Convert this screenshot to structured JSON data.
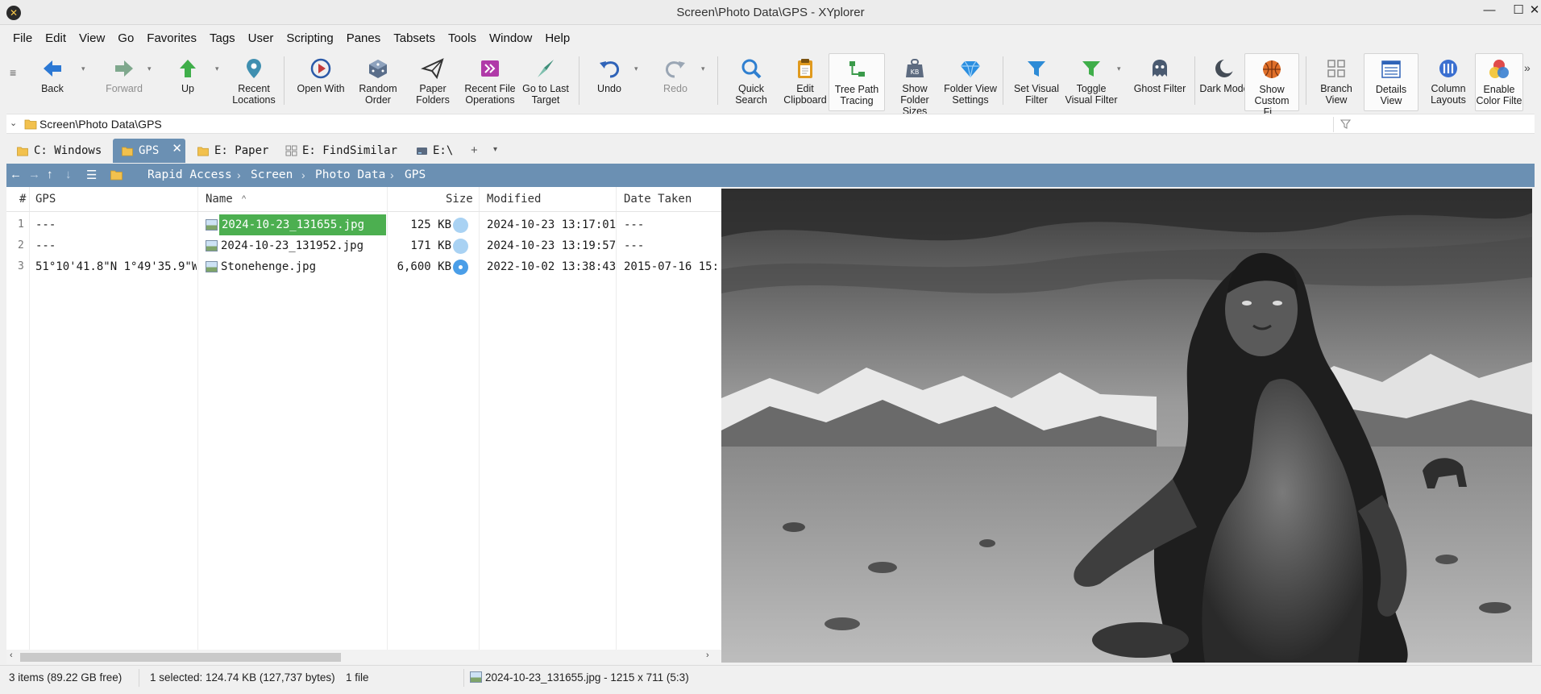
{
  "window": {
    "title": "Screen\\Photo Data\\GPS - XYplorer",
    "minimize": "—",
    "maximize": "☐",
    "close": "✕"
  },
  "menu": [
    "File",
    "Edit",
    "View",
    "Go",
    "Favorites",
    "Tags",
    "User",
    "Scripting",
    "Panes",
    "Tabsets",
    "Tools",
    "Window",
    "Help"
  ],
  "toolbar": {
    "grip": "≡",
    "overflow": "»",
    "buttons": [
      {
        "label": "Back",
        "icon": "back-arrow-icon",
        "color": "#2b78d4"
      },
      {
        "label": "Forward",
        "icon": "forward-arrow-icon",
        "color": "#7fa88d"
      },
      {
        "label": "Up",
        "icon": "up-arrow-icon",
        "color": "#3fae4a"
      },
      {
        "label": "Recent\nLocations",
        "icon": "map-pin-icon",
        "color": "#3f8fb0"
      },
      {
        "label": "Open With",
        "icon": "open-with-icon",
        "color": "#c33b3b"
      },
      {
        "label": "Random\nOrder",
        "icon": "dice-icon",
        "color": "#5a6e8a"
      },
      {
        "label": "Paper\nFolders",
        "icon": "paper-plane-icon",
        "color": "#333333"
      },
      {
        "label": "Recent File\nOperations",
        "icon": "file-operations-icon",
        "color": "#b03aa8"
      },
      {
        "label": "Go to Last\nTarget",
        "icon": "compass-needle-icon",
        "color": "#3f8f7a"
      },
      {
        "label": "Undo",
        "icon": "undo-icon",
        "color": "#2f63b8"
      },
      {
        "label": "Redo",
        "icon": "redo-icon",
        "color": "#9aa6b4"
      },
      {
        "label": "Quick\nSearch",
        "icon": "magnifier-icon",
        "color": "#2f7fd0"
      },
      {
        "label": "Edit\nClipboard",
        "icon": "clipboard-icon",
        "color": "#e09a1f"
      },
      {
        "label": "Tree Path\nTracing",
        "icon": "tree-path-icon",
        "color": "#3a9a4a"
      },
      {
        "label": "Show\nFolder Sizes",
        "icon": "folder-size-icon",
        "color": "#5d6b80"
      },
      {
        "label": "Folder View\nSettings",
        "icon": "diamond-icon",
        "color": "#2a8ee0"
      },
      {
        "label": "Set Visual\nFilter",
        "icon": "funnel-icon",
        "color": "#2d8bd6"
      },
      {
        "label": "Toggle\nVisual Filter",
        "icon": "funnel-toggle-icon",
        "color": "#3fae4a"
      },
      {
        "label": "Ghost Filter",
        "icon": "ghost-icon",
        "color": "#4a5a70"
      },
      {
        "label": "Dark Mode",
        "icon": "moon-icon",
        "color": "#444c56"
      },
      {
        "label": "Show\nCustom Fi...",
        "icon": "basketball-icon",
        "color": "#e0702a"
      },
      {
        "label": "Branch\nView",
        "icon": "branch-view-icon",
        "color": "#8a8a8a"
      },
      {
        "label": "Details View",
        "icon": "details-view-icon",
        "color": "#2f63b8"
      },
      {
        "label": "Column\nLayouts",
        "icon": "column-layouts-icon",
        "color": "#3a6fd0"
      },
      {
        "label": "Enable\nColor Filte",
        "icon": "color-filter-icon",
        "color": "#e04a4a"
      }
    ]
  },
  "address": {
    "path": "Screen\\Photo Data\\GPS",
    "expand_icon": "⌄",
    "filter_icon": "funnel-icon"
  },
  "tabs": [
    {
      "label": "C: Windows",
      "icon": "folder-icon"
    },
    {
      "label": "GPS",
      "icon": "folder-icon",
      "active": true,
      "close": "✕"
    },
    {
      "label": "E: Paper",
      "icon": "folder-icon"
    },
    {
      "label": "E: FindSimilar",
      "icon": "grid-icon"
    },
    {
      "label": "E:\\",
      "icon": "drive-icon"
    }
  ],
  "tab_controls": {
    "add": "+",
    "menu": "▾"
  },
  "breadcrumb": {
    "nav": [
      "←",
      "→",
      "↑",
      "↓",
      "☰"
    ],
    "items": [
      "Rapid Access",
      "Screen",
      "Photo Data",
      "GPS"
    ],
    "separator": "›"
  },
  "filelist": {
    "columns": {
      "num": "#",
      "gps": "GPS",
      "name": "Name",
      "sort_indicator": "^",
      "size": "Size",
      "modified": "Modified",
      "date_taken": "Date Taken"
    },
    "rows": [
      {
        "num": "1",
        "gps": "---",
        "name": "2024-10-23_131655.jpg",
        "size": "125 KB",
        "modified": "2024-10-23 13:17:01",
        "date_taken": "---",
        "selected": true,
        "has_gps": false
      },
      {
        "num": "2",
        "gps": "---",
        "name": "2024-10-23_131952.jpg",
        "size": "171 KB",
        "modified": "2024-10-23 13:19:57",
        "date_taken": "---",
        "selected": false,
        "has_gps": false
      },
      {
        "num": "3",
        "gps": "51°10'41.8\"N 1°49'35.9\"W",
        "name": "Stonehenge.jpg",
        "size": "6,600 KB",
        "modified": "2022-10-02 13:38:43",
        "date_taken": "2015-07-16 15:",
        "selected": false,
        "has_gps": true
      }
    ],
    "scroll_left": "‹",
    "scroll_right": "›"
  },
  "preview": {
    "subject": "grayscale image of a hairy crouching humanoid figure in a mountain desert landscape"
  },
  "status": {
    "items": "3 items (89.22 GB free)",
    "selected": "1 selected: 124.74 KB (127,737 bytes)",
    "files": "1 file",
    "preview_info": "2024-10-23_131655.jpg - 1215 x 711 (5:3)"
  },
  "colors": {
    "accent": "#6b90b3",
    "selection": "#4caf50",
    "size_dot": "#a9d2f3",
    "gps_dot": "#4a9ee8"
  }
}
